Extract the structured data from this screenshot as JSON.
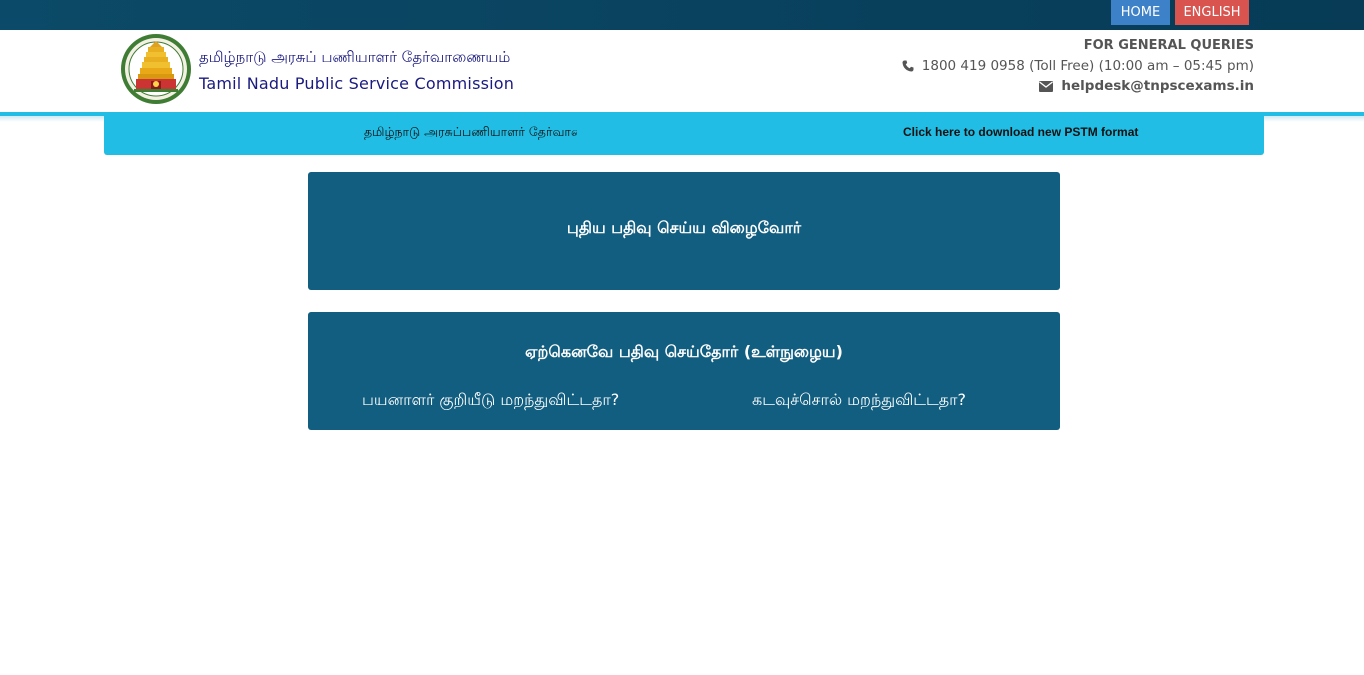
{
  "topbar": {
    "home_label": "HOME",
    "english_label": "ENGLISH"
  },
  "header": {
    "title_ta": "தமிழ்நாடு அரசுப் பணியாளர் தேர்வாணையம்",
    "title_en": "Tamil Nadu Public Service Commission",
    "queries_label": "FOR GENERAL QUERIES",
    "phone": "1800 419 0958 (Toll Free)  (10:00 am – 05:45 pm)",
    "email": "helpdesk@tnpscexams.in"
  },
  "marquee": {
    "text_ta": "தமிழ்நாடு அரசுப்பணியாளர் தேர்வாணையம்",
    "link": "Click here to download new PSTM format"
  },
  "new_registration": {
    "label": "புதிய பதிவு செய்ய விழைவோர்"
  },
  "existing_user": {
    "label": "ஏற்கெனவே பதிவு செய்தோர் (உள்நுழைய)",
    "forgot_userid": "பயனாளர் குறியீடு மறந்துவிட்டதா?",
    "forgot_password": "கடவுச்சொல் மறந்துவிட்டதா?"
  },
  "colors": {
    "topbar": "#0b4a68",
    "home_button": "#3d82c9",
    "english_button": "#d9534f",
    "accent": "#21bde4",
    "panel": "#125e80",
    "title_text": "#1a1a80"
  }
}
